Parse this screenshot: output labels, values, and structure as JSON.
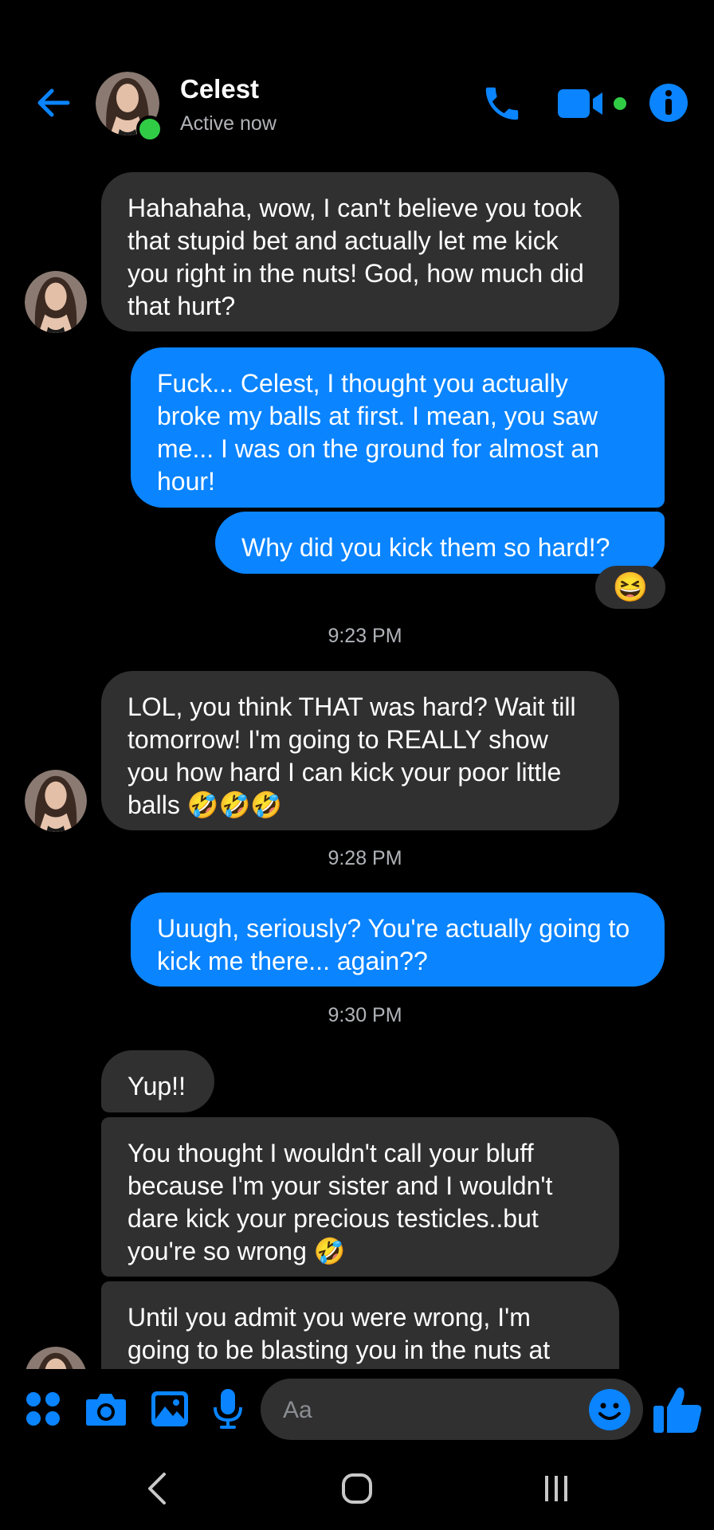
{
  "header": {
    "contact_name": "Celest",
    "status": "Active now"
  },
  "messages": [
    {
      "from": "them",
      "text": "Hahahaha, wow, I can't believe you took that stupid bet and actually let me kick you right in the nuts! God, how much did that hurt?"
    },
    {
      "from": "me",
      "text": "Fuck... Celest, I thought you actually broke my balls at first. I mean, you saw me... I was on the ground for almost an hour!"
    },
    {
      "from": "me",
      "text": "Why did you kick them so hard!?",
      "reaction": "😆"
    },
    {
      "type": "timestamp",
      "text": "9:23 PM"
    },
    {
      "from": "them",
      "text": "LOL, you think THAT was hard? Wait till tomorrow! I'm going to REALLY show you how hard I can kick your poor little balls 🤣🤣🤣"
    },
    {
      "type": "timestamp",
      "text": "9:28 PM"
    },
    {
      "from": "me",
      "text": "Uuugh, seriously? You're actually going to kick me there... again??"
    },
    {
      "type": "timestamp",
      "text": "9:30 PM"
    },
    {
      "from": "them",
      "text": "Yup!!"
    },
    {
      "from": "them",
      "text": "You thought I wouldn't call your bluff because I'm your sister and I wouldn't dare kick your precious testicles..but you're so wrong 🤣"
    },
    {
      "from": "them",
      "text": "Until you admit you were wrong, I'm going to be blasting you in the nuts at"
    }
  ],
  "composer": {
    "placeholder": "Aa"
  },
  "colors": {
    "accent": "#0a84ff",
    "incoming_bubble": "#303030",
    "online": "#31cc46",
    "secondary_text": "#b0b3b8"
  },
  "icons": {
    "header": [
      "back-arrow-icon",
      "phone-icon",
      "video-camera-icon",
      "info-icon"
    ],
    "composer": [
      "apps-grid-icon",
      "camera-icon",
      "gallery-icon",
      "microphone-icon",
      "emoji-icon",
      "thumbs-up-icon"
    ],
    "navbar": [
      "nav-back-icon",
      "nav-home-icon",
      "nav-recents-icon"
    ]
  }
}
